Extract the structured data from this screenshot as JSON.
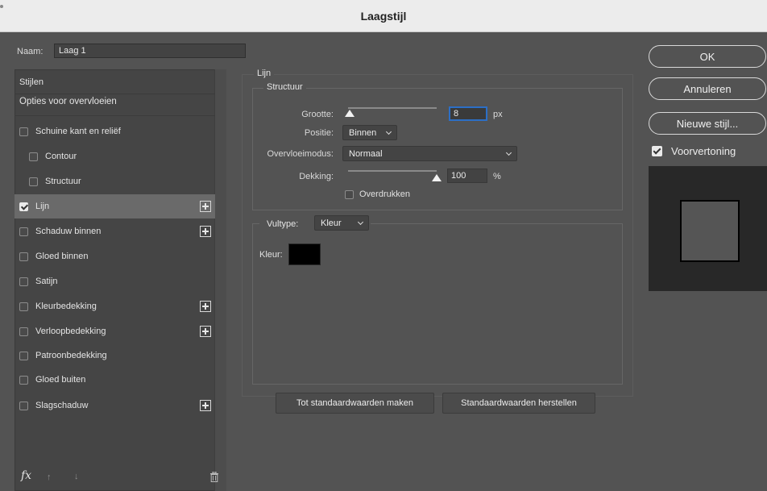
{
  "window": {
    "title": "Laagstijl"
  },
  "name": {
    "label": "Naam:",
    "value": "Laag 1"
  },
  "styles": {
    "header": "Stijlen",
    "blend_options": "Opties voor overvloeien",
    "items": [
      {
        "label": "Schuine kant en reliëf",
        "checked": false,
        "sub": false,
        "plus": false
      },
      {
        "label": "Contour",
        "checked": false,
        "sub": true,
        "plus": false
      },
      {
        "label": "Structuur",
        "checked": false,
        "sub": true,
        "plus": false
      },
      {
        "label": "Lijn",
        "checked": true,
        "sub": false,
        "plus": true,
        "selected": true
      },
      {
        "label": "Schaduw binnen",
        "checked": false,
        "sub": false,
        "plus": true
      },
      {
        "label": "Gloed binnen",
        "checked": false,
        "sub": false,
        "plus": false
      },
      {
        "label": "Satijn",
        "checked": false,
        "sub": false,
        "plus": false
      },
      {
        "label": "Kleurbedekking",
        "checked": false,
        "sub": false,
        "plus": true
      },
      {
        "label": "Verloopbedekking",
        "checked": false,
        "sub": false,
        "plus": true
      },
      {
        "label": "Patroonbedekking",
        "checked": false,
        "sub": false,
        "plus": false
      },
      {
        "label": "Gloed buiten",
        "checked": false,
        "sub": false,
        "plus": false
      },
      {
        "label": "Slagschaduw",
        "checked": false,
        "sub": false,
        "plus": true
      }
    ],
    "footer": {
      "fx": "fx",
      "up_arrow": "↑",
      "down_arrow": "↓"
    }
  },
  "stroke": {
    "section_title": "Lijn",
    "structure_title": "Structuur",
    "size": {
      "label": "Grootte:",
      "value": "8",
      "unit": "px",
      "slider_fraction": 0.02
    },
    "position": {
      "label": "Positie:",
      "value": "Binnen"
    },
    "blend_mode": {
      "label": "Overvloeimodus:",
      "value": "Normaal"
    },
    "opacity": {
      "label": "Dekking:",
      "value": "100",
      "unit": "%",
      "slider_fraction": 1.0
    },
    "overprint": {
      "label": "Overdrukken",
      "checked": false
    },
    "fill_type": {
      "label": "Vultype:",
      "value": "Kleur"
    },
    "color": {
      "label": "Kleur:",
      "hex": "#000000"
    }
  },
  "buttons": {
    "make_default": "Tot standaardwaarden maken",
    "reset_default": "Standaardwaarden herstellen",
    "ok": "OK",
    "cancel": "Annuleren",
    "new_style": "Nieuwe stijl..."
  },
  "preview": {
    "label": "Voorvertoning",
    "checked": true
  }
}
